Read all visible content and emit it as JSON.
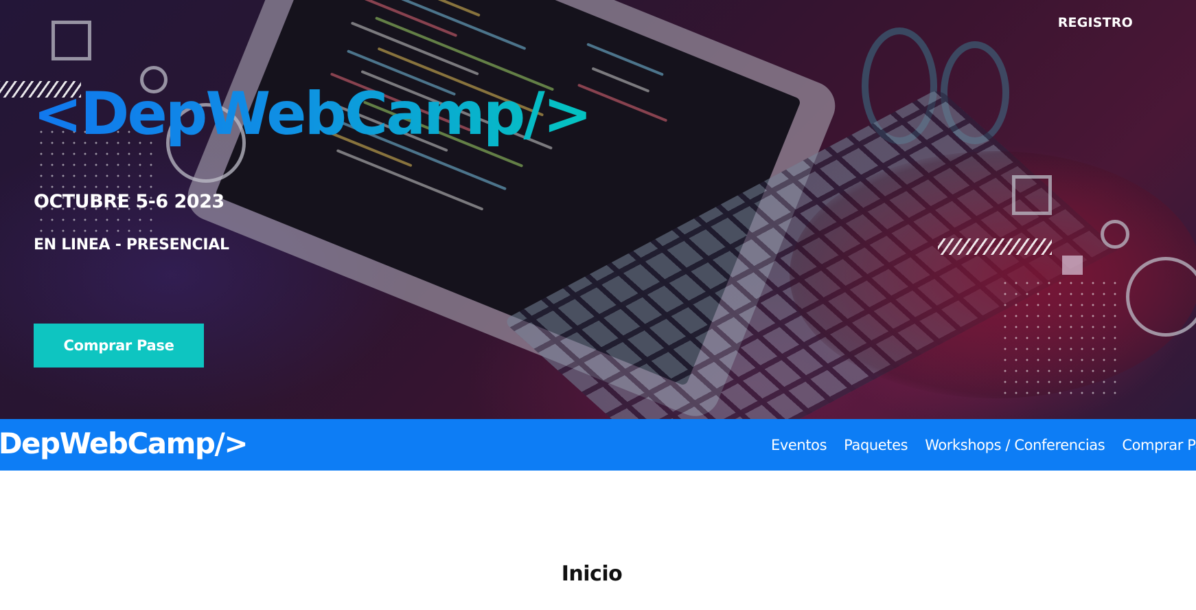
{
  "header": {
    "registro_label": "REGISTRO"
  },
  "hero": {
    "brand": "<DepWebCamp/>",
    "date": "OCTUBRE 5-6 2023",
    "mode": "EN LINEA - PRESENCIAL",
    "cta_label": "Comprar Pase"
  },
  "navbar": {
    "brand": "<DepWebCamp/>",
    "links": [
      "Eventos",
      "Paquetes",
      "Workshops / Conferencias",
      "Comprar Pase"
    ]
  },
  "main": {
    "section_title": "Inicio"
  },
  "colors": {
    "accent_blue": "#0d7df5",
    "accent_teal": "#0ec5c1"
  }
}
